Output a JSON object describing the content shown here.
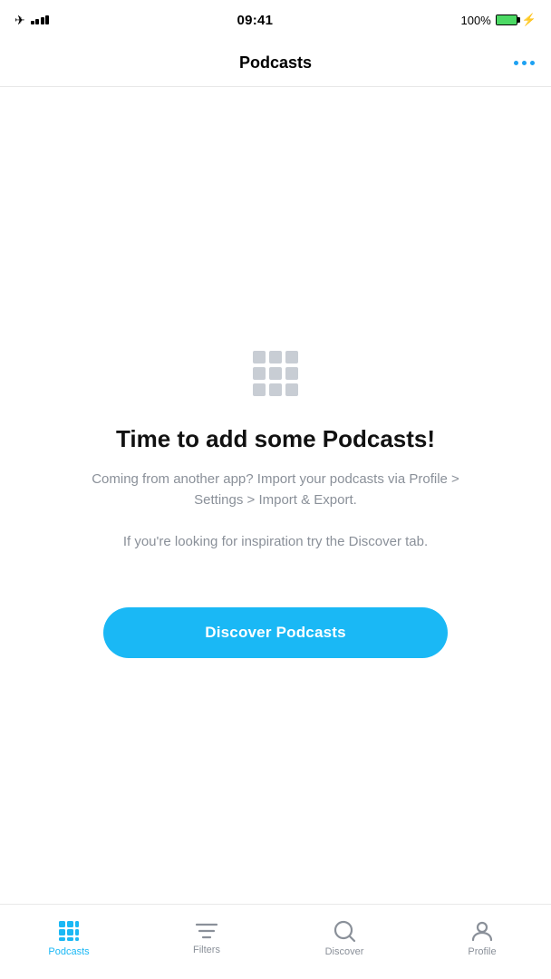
{
  "statusBar": {
    "time": "09:41",
    "battery": "100%"
  },
  "header": {
    "title": "Podcasts",
    "moreLabel": "more-options"
  },
  "emptyState": {
    "title": "Time to add some Podcasts!",
    "subtitle": "Coming from another app? Import your podcasts via Profile > Settings > Import & Export.",
    "hint": "If you're looking for inspiration try the Discover tab.",
    "discoverButton": "Discover Podcasts"
  },
  "bottomNav": {
    "items": [
      {
        "id": "podcasts",
        "label": "Podcasts",
        "active": true
      },
      {
        "id": "filters",
        "label": "Filters",
        "active": false
      },
      {
        "id": "discover",
        "label": "Discover",
        "active": false
      },
      {
        "id": "profile",
        "label": "Profile",
        "active": false
      }
    ]
  }
}
